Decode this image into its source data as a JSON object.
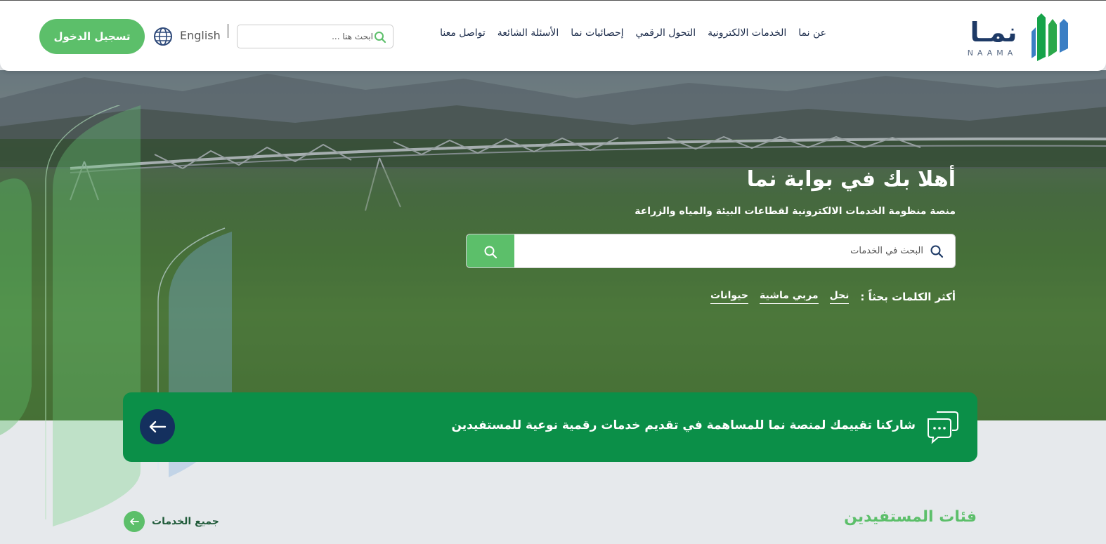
{
  "header": {
    "login_label": "تسجيل الدخول",
    "language_label": "English",
    "search_placeholder": "ابحث هنا ...",
    "nav": [
      {
        "label": "عن نما"
      },
      {
        "label": "الخدمات الالكترونية"
      },
      {
        "label": "التحول الرقمي"
      },
      {
        "label": "إحصائيات نما"
      },
      {
        "label": "الأسئلة الشائعة"
      },
      {
        "label": "تواصل معنا"
      }
    ],
    "logo": {
      "arabic": "نمـا",
      "latin": "NAAMA"
    }
  },
  "hero": {
    "title": "أهلا بك في بوابة نما",
    "subtitle": "منصة منظومة الخدمات الالكترونية لقطاعات البيئة والمياه والزراعة",
    "search_placeholder": "البحث في الخدمات",
    "keywords_label": "أكثر الكلمات بحثاً :",
    "keywords": [
      "نحل",
      "مربي ماشية",
      "حيوانات"
    ]
  },
  "feedback": {
    "text": "شاركنا تقييمك لمنصة نما للمساهمة في تقديم خدمات رقمية نوعية للمستفيدين"
  },
  "section": {
    "title": "فئات المستفيدين",
    "all_services_label": "جميع الخدمات"
  },
  "colors": {
    "primary_green": "#5cbf6a",
    "banner_green": "#0b8f48",
    "navy": "#14305e",
    "nav_text": "#1b2b4a"
  }
}
